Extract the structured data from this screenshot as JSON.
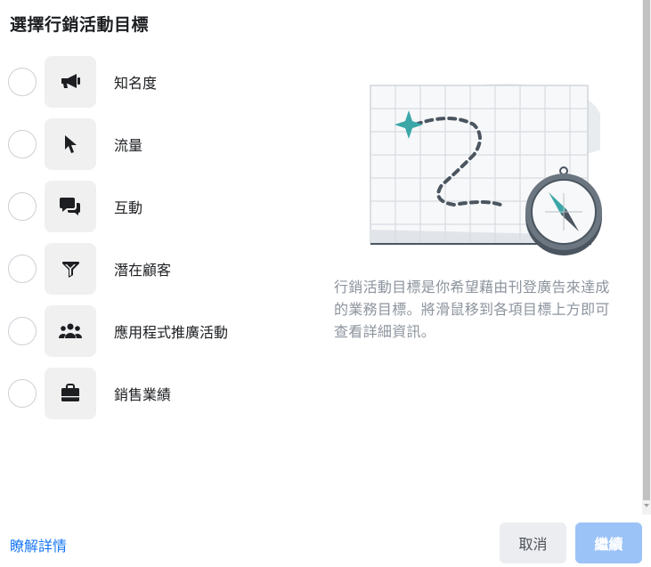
{
  "dialog": {
    "title": "選擇行銷活動目標"
  },
  "objectives": [
    {
      "label": "知名度",
      "icon": "megaphone-icon",
      "selected": false
    },
    {
      "label": "流量",
      "icon": "cursor-icon",
      "selected": false
    },
    {
      "label": "互動",
      "icon": "chat-bubbles-icon",
      "selected": false
    },
    {
      "label": "潛在顧客",
      "icon": "funnel-icon",
      "selected": false
    },
    {
      "label": "應用程式推廣活動",
      "icon": "people-icon",
      "selected": false
    },
    {
      "label": "銷售業績",
      "icon": "briefcase-icon",
      "selected": false
    }
  ],
  "description": "行銷活動目標是你希望藉由刊登廣告來達成的業務目標。將滑鼠移到各項目標上方即可查看詳細資訊。",
  "footer": {
    "learn_more": "瞭解詳情",
    "cancel_label": "取消",
    "continue_label": "繼續"
  },
  "colors": {
    "accent": "#1877f2",
    "continue_disabled": "#9cc3f7",
    "icon_dark": "#1c1e21",
    "map_teal": "#3ba7a7",
    "compass_dark": "#4a5560"
  }
}
